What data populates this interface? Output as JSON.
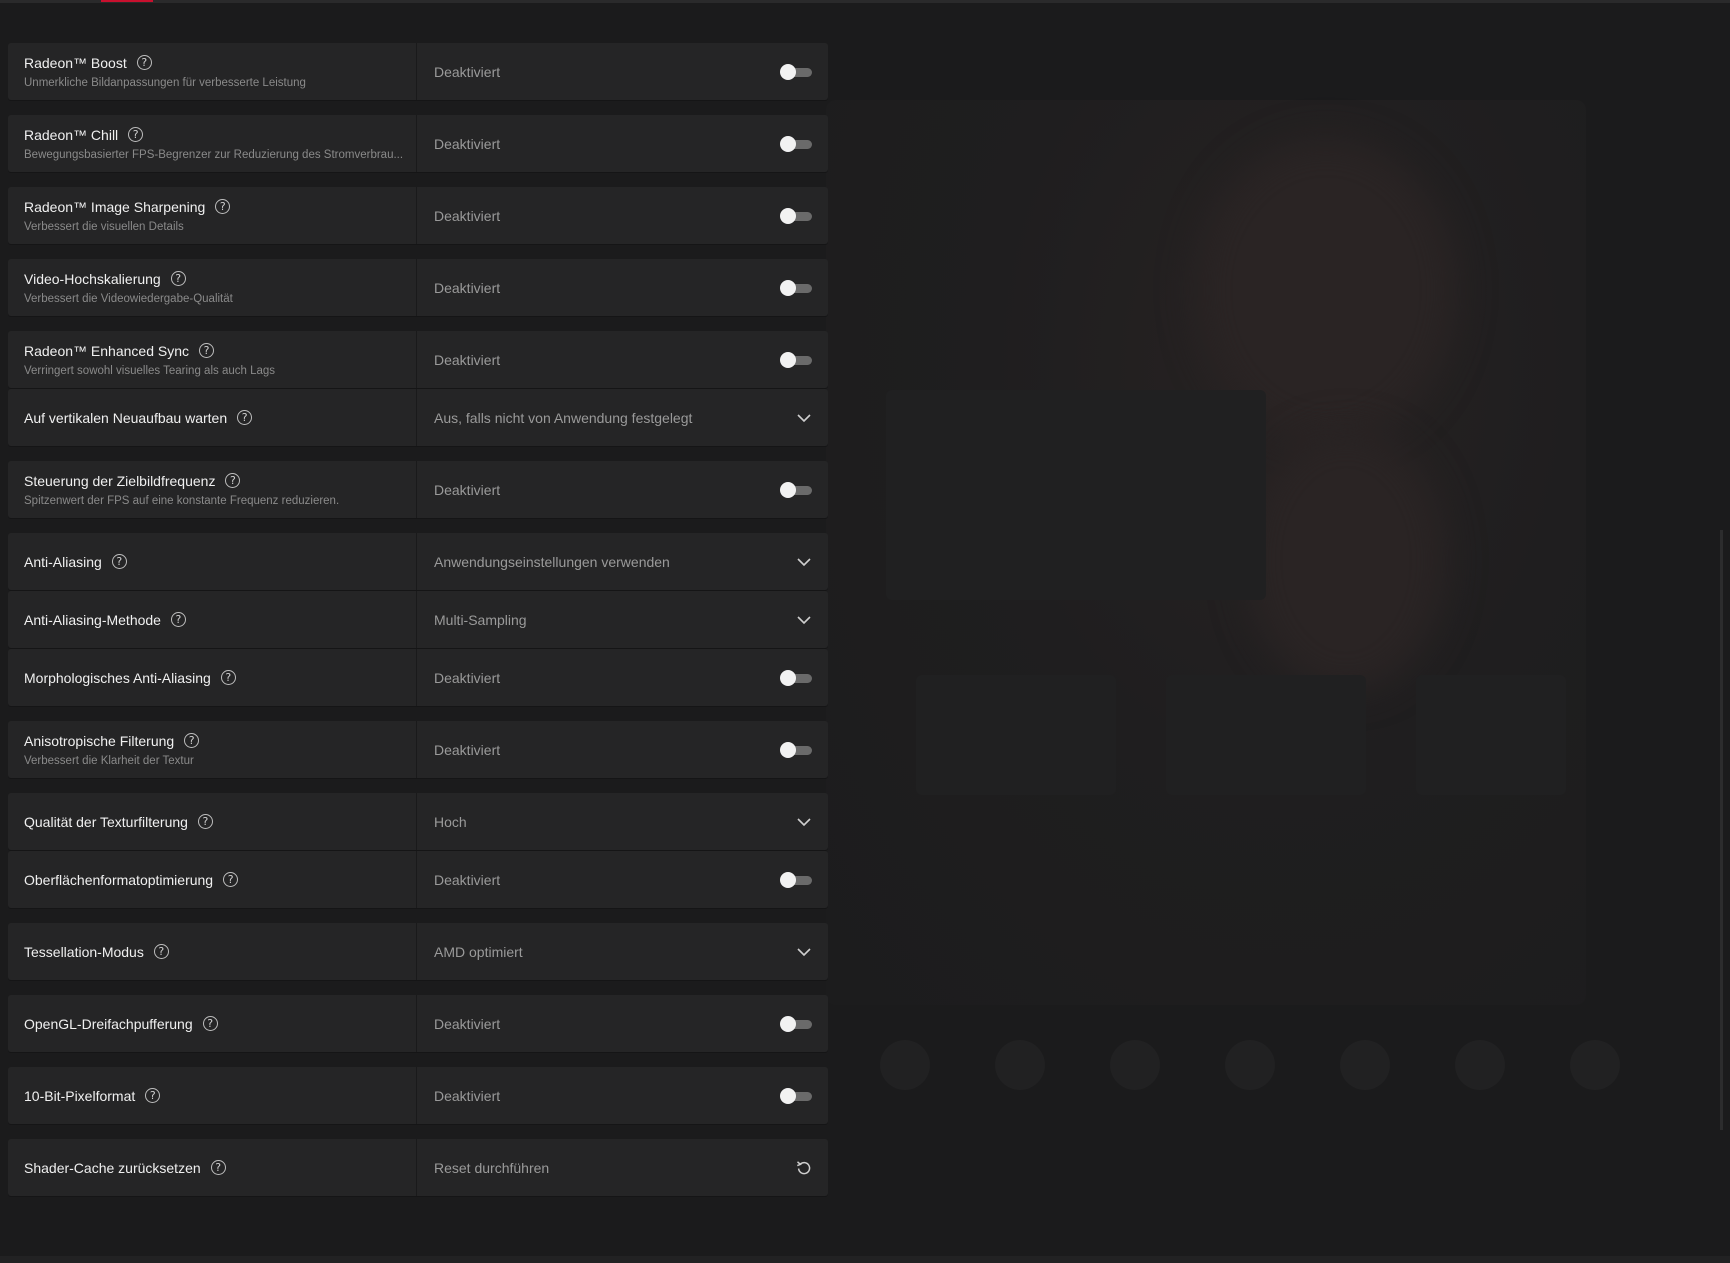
{
  "window": {
    "accent_color": "#c8102e"
  },
  "settings": [
    {
      "title": "Radeon™ Boost",
      "desc": "Unmerkliche Bildanpassungen für verbesserte Leistung",
      "value": "Deaktiviert",
      "control": "toggle-icon"
    },
    {
      "title": "Radeon™ Chill",
      "desc": "Bewegungsbasierter FPS-Begrenzer zur Reduzierung des Stromverbrau...",
      "value": "Deaktiviert",
      "control": "toggle-icon"
    },
    {
      "title": "Radeon™ Image Sharpening",
      "desc": "Verbessert die visuellen Details",
      "value": "Deaktiviert",
      "control": "toggle-icon"
    },
    {
      "title": "Video-Hochskalierung",
      "desc": "Verbessert die Videowiedergabe-Qualität",
      "value": "Deaktiviert",
      "control": "toggle-icon"
    },
    {
      "title": "Radeon™ Enhanced Sync",
      "desc": "Verringert sowohl visuelles Tearing als auch Lags",
      "value": "Deaktiviert",
      "control": "toggle-icon"
    },
    {
      "title": "Auf vertikalen Neuaufbau warten",
      "desc": "",
      "value": "Aus, falls nicht von Anwendung festgelegt",
      "control": "chevron-down-icon"
    },
    {
      "title": "Steuerung der Zielbildfrequenz",
      "desc": "Spitzenwert der FPS auf eine konstante Frequenz reduzieren.",
      "value": "Deaktiviert",
      "control": "toggle-icon"
    },
    {
      "title": "Anti-Aliasing",
      "desc": "",
      "value": "Anwendungseinstellungen verwenden",
      "control": "chevron-down-icon"
    },
    {
      "title": "Anti-Aliasing-Methode",
      "desc": "",
      "value": "Multi-Sampling",
      "control": "chevron-down-icon"
    },
    {
      "title": "Morphologisches Anti-Aliasing",
      "desc": "",
      "value": "Deaktiviert",
      "control": "toggle-icon"
    },
    {
      "title": "Anisotropische Filterung",
      "desc": "Verbessert die Klarheit der Textur",
      "value": "Deaktiviert",
      "control": "toggle-icon"
    },
    {
      "title": "Qualität der Texturfilterung",
      "desc": "",
      "value": "Hoch",
      "control": "chevron-down-icon"
    },
    {
      "title": "Oberflächenformatoptimierung",
      "desc": "",
      "value": "Deaktiviert",
      "control": "toggle-icon"
    },
    {
      "title": "Tessellation-Modus",
      "desc": "",
      "value": "AMD optimiert",
      "control": "chevron-down-icon"
    },
    {
      "title": "OpenGL-Dreifachpufferung",
      "desc": "",
      "value": "Deaktiviert",
      "control": "toggle-icon"
    },
    {
      "title": "10-Bit-Pixelformat",
      "desc": "",
      "value": "Deaktiviert",
      "control": "toggle-icon"
    },
    {
      "title": "Shader-Cache zurücksetzen",
      "desc": "",
      "value": "Reset durchführen",
      "control": "reset-icon"
    }
  ]
}
